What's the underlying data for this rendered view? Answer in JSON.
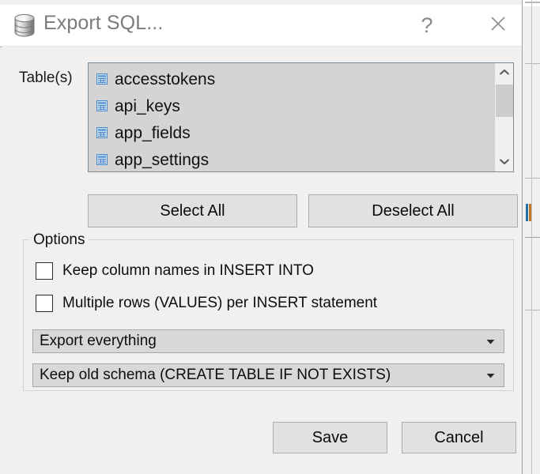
{
  "window": {
    "title": "Export SQL...",
    "icon": "database-icon",
    "help_label": "?",
    "close_label": "✕"
  },
  "tables_section": {
    "label": "Table(s)",
    "items": [
      {
        "name": "accesstokens",
        "icon": "table-icon"
      },
      {
        "name": "api_keys",
        "icon": "table-icon"
      },
      {
        "name": "app_fields",
        "icon": "table-icon"
      },
      {
        "name": "app_settings",
        "icon": "table-icon"
      }
    ],
    "scrollbar": {
      "up_icon": "chevron-up-icon",
      "down_icon": "chevron-down-icon"
    },
    "select_all_label": "Select All",
    "deselect_all_label": "Deselect All"
  },
  "options": {
    "legend": "Options",
    "checkboxes": [
      {
        "label": "Keep column names in INSERT INTO",
        "checked": false
      },
      {
        "label": "Multiple rows (VALUES) per INSERT statement",
        "checked": false
      }
    ],
    "dropdowns": [
      {
        "name": "export-scope",
        "selected": "Export everything",
        "arrow_icon": "triangle-down-icon"
      },
      {
        "name": "schema-mode",
        "selected": "Keep old schema (CREATE TABLE IF NOT EXISTS)",
        "arrow_icon": "triangle-down-icon"
      }
    ]
  },
  "footer": {
    "save_label": "Save",
    "cancel_label": "Cancel"
  },
  "colors": {
    "dialog_bg": "#f0f0f0",
    "titlebar_bg": "#ffffff",
    "title_text": "#7b7b7b",
    "listbox_bg": "#d4d4d4",
    "listbox_border": "#7d8b99",
    "button_bg": "#e1e1e1",
    "button_border": "#adadad",
    "combo_bg": "#d8d8d8",
    "table_icon": "#5b9bd5",
    "accent_blue": "#1b6196"
  }
}
